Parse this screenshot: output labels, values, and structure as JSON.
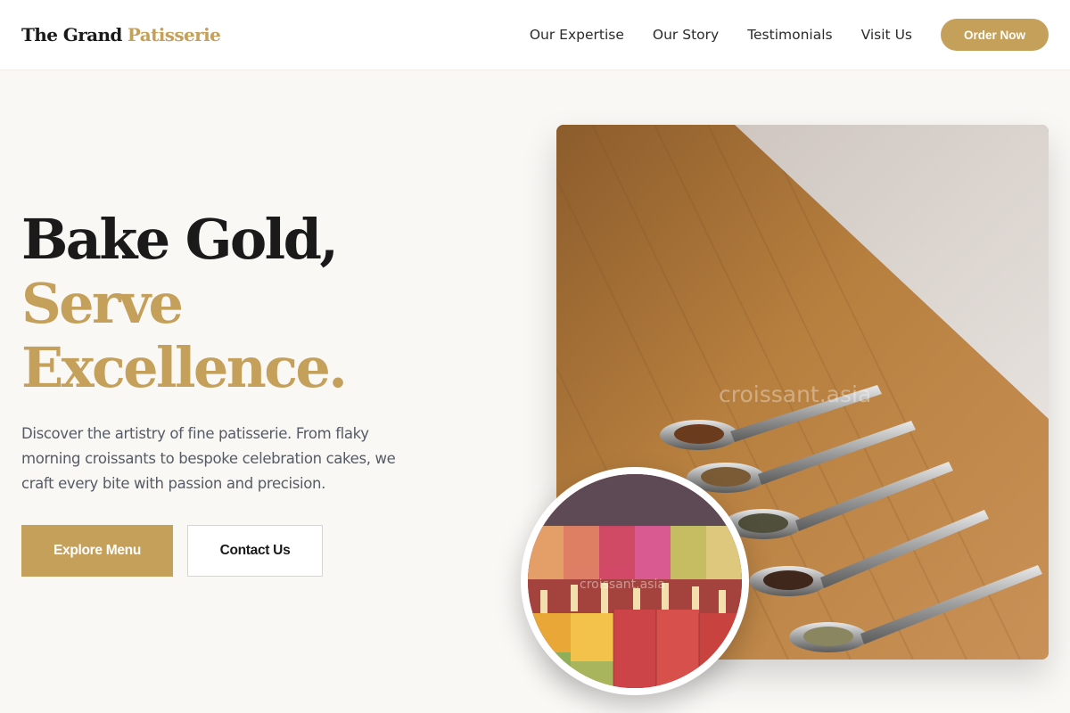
{
  "header": {
    "brand_main": "The Grand",
    "brand_accent": "Patisserie",
    "nav": [
      "Our Expertise",
      "Our Story",
      "Testimonials",
      "Visit Us"
    ],
    "cta": "Order Now"
  },
  "hero": {
    "title_line1": "Bake Gold,",
    "title_line2": "Serve",
    "title_line3": "Excellence.",
    "description": "Discover the artistry of fine patisserie. From flaky morning croissants to bespoke celebration cakes, we craft every bite with passion and precision.",
    "primary_button": "Explore Menu",
    "secondary_button": "Contact Us"
  },
  "images": {
    "main_watermark": "croissant.asia",
    "circle_watermark": "croissant.asia"
  },
  "colors": {
    "accent": "#c4a05a",
    "background": "#faf8f5",
    "text_dark": "#1a1a1a",
    "text_muted": "#555b66"
  }
}
